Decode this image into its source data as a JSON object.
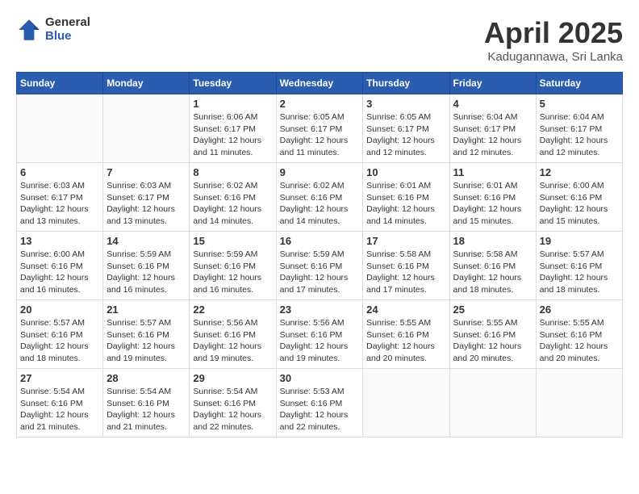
{
  "header": {
    "logo_general": "General",
    "logo_blue": "Blue",
    "month": "April 2025",
    "location": "Kadugannawa, Sri Lanka"
  },
  "days_of_week": [
    "Sunday",
    "Monday",
    "Tuesday",
    "Wednesday",
    "Thursday",
    "Friday",
    "Saturday"
  ],
  "weeks": [
    [
      {
        "day": "",
        "sunrise": "",
        "sunset": "",
        "daylight": ""
      },
      {
        "day": "",
        "sunrise": "",
        "sunset": "",
        "daylight": ""
      },
      {
        "day": "1",
        "sunrise": "Sunrise: 6:06 AM",
        "sunset": "Sunset: 6:17 PM",
        "daylight": "Daylight: 12 hours and 11 minutes."
      },
      {
        "day": "2",
        "sunrise": "Sunrise: 6:05 AM",
        "sunset": "Sunset: 6:17 PM",
        "daylight": "Daylight: 12 hours and 11 minutes."
      },
      {
        "day": "3",
        "sunrise": "Sunrise: 6:05 AM",
        "sunset": "Sunset: 6:17 PM",
        "daylight": "Daylight: 12 hours and 12 minutes."
      },
      {
        "day": "4",
        "sunrise": "Sunrise: 6:04 AM",
        "sunset": "Sunset: 6:17 PM",
        "daylight": "Daylight: 12 hours and 12 minutes."
      },
      {
        "day": "5",
        "sunrise": "Sunrise: 6:04 AM",
        "sunset": "Sunset: 6:17 PM",
        "daylight": "Daylight: 12 hours and 12 minutes."
      }
    ],
    [
      {
        "day": "6",
        "sunrise": "Sunrise: 6:03 AM",
        "sunset": "Sunset: 6:17 PM",
        "daylight": "Daylight: 12 hours and 13 minutes."
      },
      {
        "day": "7",
        "sunrise": "Sunrise: 6:03 AM",
        "sunset": "Sunset: 6:17 PM",
        "daylight": "Daylight: 12 hours and 13 minutes."
      },
      {
        "day": "8",
        "sunrise": "Sunrise: 6:02 AM",
        "sunset": "Sunset: 6:16 PM",
        "daylight": "Daylight: 12 hours and 14 minutes."
      },
      {
        "day": "9",
        "sunrise": "Sunrise: 6:02 AM",
        "sunset": "Sunset: 6:16 PM",
        "daylight": "Daylight: 12 hours and 14 minutes."
      },
      {
        "day": "10",
        "sunrise": "Sunrise: 6:01 AM",
        "sunset": "Sunset: 6:16 PM",
        "daylight": "Daylight: 12 hours and 14 minutes."
      },
      {
        "day": "11",
        "sunrise": "Sunrise: 6:01 AM",
        "sunset": "Sunset: 6:16 PM",
        "daylight": "Daylight: 12 hours and 15 minutes."
      },
      {
        "day": "12",
        "sunrise": "Sunrise: 6:00 AM",
        "sunset": "Sunset: 6:16 PM",
        "daylight": "Daylight: 12 hours and 15 minutes."
      }
    ],
    [
      {
        "day": "13",
        "sunrise": "Sunrise: 6:00 AM",
        "sunset": "Sunset: 6:16 PM",
        "daylight": "Daylight: 12 hours and 16 minutes."
      },
      {
        "day": "14",
        "sunrise": "Sunrise: 5:59 AM",
        "sunset": "Sunset: 6:16 PM",
        "daylight": "Daylight: 12 hours and 16 minutes."
      },
      {
        "day": "15",
        "sunrise": "Sunrise: 5:59 AM",
        "sunset": "Sunset: 6:16 PM",
        "daylight": "Daylight: 12 hours and 16 minutes."
      },
      {
        "day": "16",
        "sunrise": "Sunrise: 5:59 AM",
        "sunset": "Sunset: 6:16 PM",
        "daylight": "Daylight: 12 hours and 17 minutes."
      },
      {
        "day": "17",
        "sunrise": "Sunrise: 5:58 AM",
        "sunset": "Sunset: 6:16 PM",
        "daylight": "Daylight: 12 hours and 17 minutes."
      },
      {
        "day": "18",
        "sunrise": "Sunrise: 5:58 AM",
        "sunset": "Sunset: 6:16 PM",
        "daylight": "Daylight: 12 hours and 18 minutes."
      },
      {
        "day": "19",
        "sunrise": "Sunrise: 5:57 AM",
        "sunset": "Sunset: 6:16 PM",
        "daylight": "Daylight: 12 hours and 18 minutes."
      }
    ],
    [
      {
        "day": "20",
        "sunrise": "Sunrise: 5:57 AM",
        "sunset": "Sunset: 6:16 PM",
        "daylight": "Daylight: 12 hours and 18 minutes."
      },
      {
        "day": "21",
        "sunrise": "Sunrise: 5:57 AM",
        "sunset": "Sunset: 6:16 PM",
        "daylight": "Daylight: 12 hours and 19 minutes."
      },
      {
        "day": "22",
        "sunrise": "Sunrise: 5:56 AM",
        "sunset": "Sunset: 6:16 PM",
        "daylight": "Daylight: 12 hours and 19 minutes."
      },
      {
        "day": "23",
        "sunrise": "Sunrise: 5:56 AM",
        "sunset": "Sunset: 6:16 PM",
        "daylight": "Daylight: 12 hours and 19 minutes."
      },
      {
        "day": "24",
        "sunrise": "Sunrise: 5:55 AM",
        "sunset": "Sunset: 6:16 PM",
        "daylight": "Daylight: 12 hours and 20 minutes."
      },
      {
        "day": "25",
        "sunrise": "Sunrise: 5:55 AM",
        "sunset": "Sunset: 6:16 PM",
        "daylight": "Daylight: 12 hours and 20 minutes."
      },
      {
        "day": "26",
        "sunrise": "Sunrise: 5:55 AM",
        "sunset": "Sunset: 6:16 PM",
        "daylight": "Daylight: 12 hours and 20 minutes."
      }
    ],
    [
      {
        "day": "27",
        "sunrise": "Sunrise: 5:54 AM",
        "sunset": "Sunset: 6:16 PM",
        "daylight": "Daylight: 12 hours and 21 minutes."
      },
      {
        "day": "28",
        "sunrise": "Sunrise: 5:54 AM",
        "sunset": "Sunset: 6:16 PM",
        "daylight": "Daylight: 12 hours and 21 minutes."
      },
      {
        "day": "29",
        "sunrise": "Sunrise: 5:54 AM",
        "sunset": "Sunset: 6:16 PM",
        "daylight": "Daylight: 12 hours and 22 minutes."
      },
      {
        "day": "30",
        "sunrise": "Sunrise: 5:53 AM",
        "sunset": "Sunset: 6:16 PM",
        "daylight": "Daylight: 12 hours and 22 minutes."
      },
      {
        "day": "",
        "sunrise": "",
        "sunset": "",
        "daylight": ""
      },
      {
        "day": "",
        "sunrise": "",
        "sunset": "",
        "daylight": ""
      },
      {
        "day": "",
        "sunrise": "",
        "sunset": "",
        "daylight": ""
      }
    ]
  ]
}
